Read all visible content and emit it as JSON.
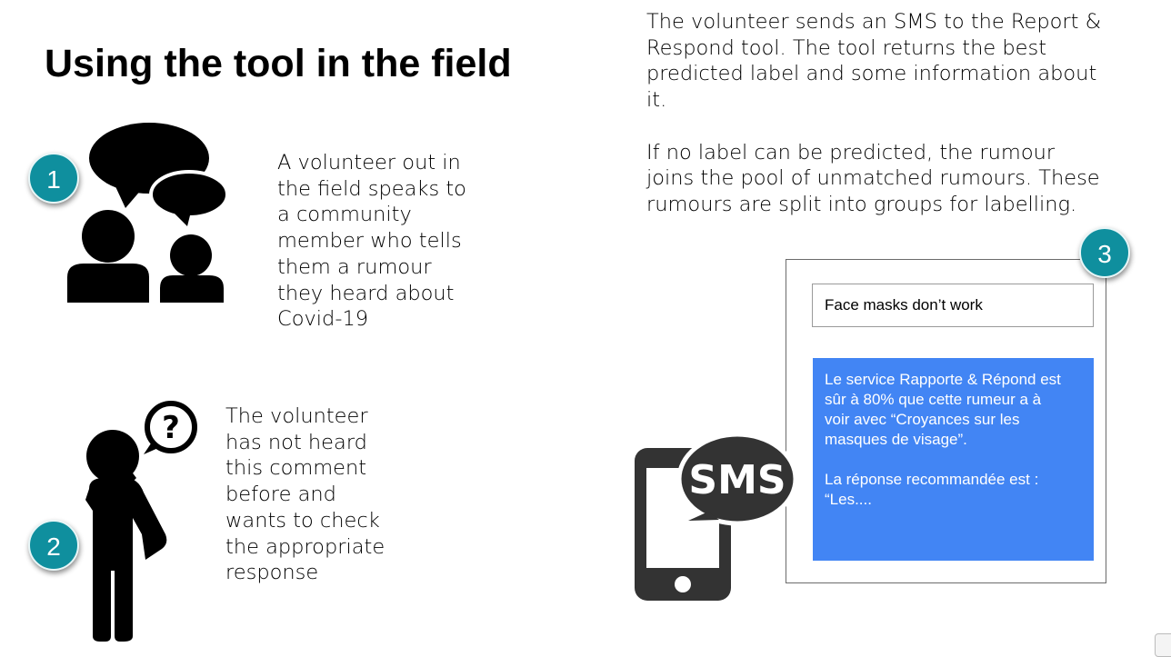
{
  "slide": {
    "title": "Using the tool in the field",
    "step1": {
      "badge": "1",
      "text": "A volunteer out in\nthe field speaks to\na community\nmember who tells\nthem a rumour\nthey heard about\nCovid-19",
      "icon": "two-people-talking-icon"
    },
    "step2": {
      "badge": "2",
      "text": "The volunteer\nhas not heard\nthis comment\nbefore and\nwants to check\nthe appropriate\nresponse",
      "icon": "thinking-person-question-icon"
    },
    "step3": {
      "badge": "3",
      "text": "The volunteer sends an SMS to the Report &\nRespond tool. The tool returns the best\npredicted label and some information about\nit.\n\nIf no label can be predicted, the rumour\njoins the pool of unmatched rumours. These\nrumours are split into groups for labelling.",
      "icon": "sms-phone-icon",
      "sms_icon_text": "SMS",
      "sms_message": "Face masks don’t work",
      "reply_message": "Le service Rapporte & Répond est\nsûr à 80% que cette rumeur a à\nvoir avec “Croyances sur les\nmasques de visage”.\n\nLa réponse recommandée est :\n“Les...."
    }
  },
  "colors": {
    "badge": "#0f8f9e",
    "reply_background": "#4285f4",
    "icon": "#000000",
    "phone_icon": "#333333"
  }
}
